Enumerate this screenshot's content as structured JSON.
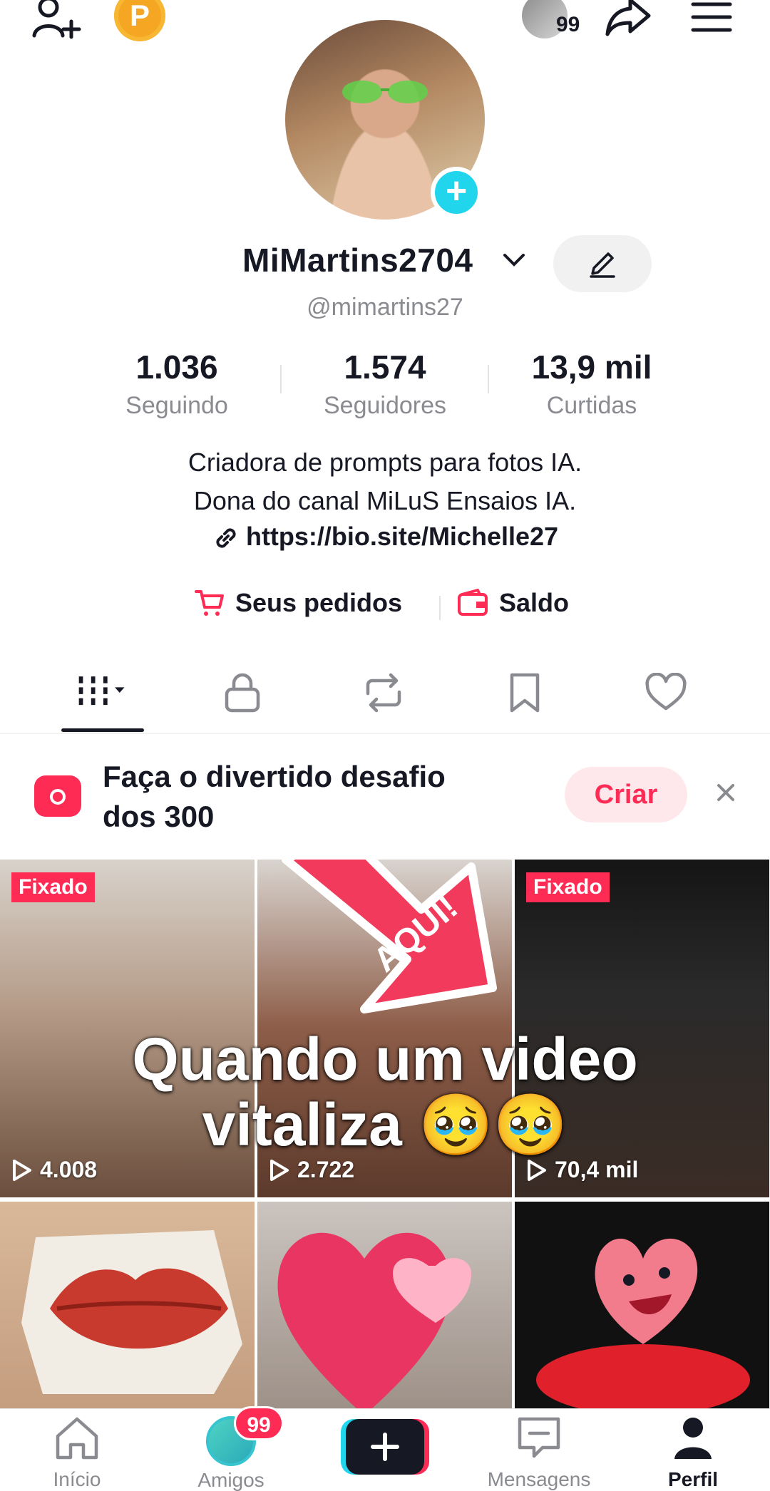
{
  "topbar": {
    "story_count": "99",
    "coin_letter": "P"
  },
  "profile": {
    "display_name": "MiMartins2704",
    "handle": "@mimartins27",
    "stats": [
      {
        "value": "1.036",
        "label": "Seguindo"
      },
      {
        "value": "1.574",
        "label": "Seguidores"
      },
      {
        "value": "13,9 mil",
        "label": "Curtidas"
      }
    ],
    "bio_lines": [
      "Criadora de prompts para fotos IA.",
      "Dona do canal MiLuS Ensaios IA."
    ],
    "link": "https://bio.site/Michelle27",
    "shop": {
      "orders_label": "Seus pedidos",
      "balance_label": "Saldo"
    }
  },
  "challenge": {
    "text": "Faça o divertido desafio dos 300",
    "button_label": "Criar"
  },
  "videos": [
    {
      "pinned_label": "Fixado",
      "views": "4.008"
    },
    {
      "pinned_label": "",
      "views": "2.722",
      "sticker_text": "AQUI!"
    },
    {
      "pinned_label": "Fixado",
      "views": "70,4 mil"
    },
    {
      "pinned_label": "",
      "views": ""
    },
    {
      "pinned_label": "",
      "views": ""
    },
    {
      "pinned_label": "",
      "views": ""
    }
  ],
  "overlay_caption": {
    "line1": "Quando um video",
    "line2": "vitaliza 🥹🥹"
  },
  "bottom_nav": {
    "home_label": "Início",
    "friends_label": "Amigos",
    "friends_badge": "99",
    "messages_label": "Mensagens",
    "profile_label": "Perfil"
  },
  "colors": {
    "accent": "#fe2c55",
    "cyan": "#20d5ec",
    "text": "#161823",
    "muted": "#8a8b91"
  }
}
